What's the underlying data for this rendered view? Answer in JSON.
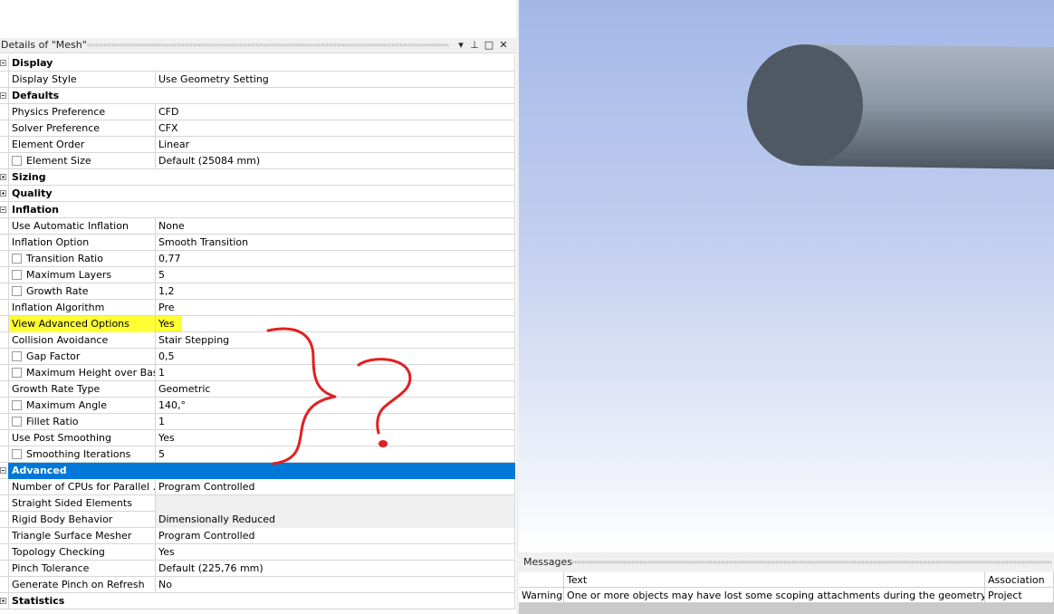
{
  "details_panel": {
    "title": "Details of \"Mesh\"",
    "header_icons": {
      "dropdown": "▾",
      "pin": "⊥",
      "maximize": "□",
      "close": "✕"
    }
  },
  "rows": [
    {
      "type": "section",
      "label": "Display",
      "toggle": "minus"
    },
    {
      "type": "prop",
      "label": "Display Style",
      "value": "Use Geometry Setting"
    },
    {
      "type": "section",
      "label": "Defaults",
      "toggle": "minus"
    },
    {
      "type": "prop",
      "label": "Physics Preference",
      "value": "CFD"
    },
    {
      "type": "prop",
      "label": "Solver Preference",
      "value": "CFX"
    },
    {
      "type": "prop",
      "label": "Element Order",
      "value": "Linear"
    },
    {
      "type": "prop",
      "label": "Element Size",
      "value": "Default (25084 mm)",
      "checkbox": true
    },
    {
      "type": "section",
      "label": "Sizing",
      "toggle": "plus"
    },
    {
      "type": "section",
      "label": "Quality",
      "toggle": "plus"
    },
    {
      "type": "section",
      "label": "Inflation",
      "toggle": "minus"
    },
    {
      "type": "prop",
      "label": "Use Automatic Inflation",
      "value": "None"
    },
    {
      "type": "prop",
      "label": "Inflation Option",
      "value": "Smooth Transition"
    },
    {
      "type": "prop",
      "label": "Transition Ratio",
      "value": "0,77",
      "checkbox": true
    },
    {
      "type": "prop",
      "label": "Maximum Layers",
      "value": "5",
      "checkbox": true
    },
    {
      "type": "prop",
      "label": "Growth Rate",
      "value": "1,2",
      "checkbox": true
    },
    {
      "type": "prop",
      "label": "Inflation Algorithm",
      "value": "Pre"
    },
    {
      "type": "prop",
      "label": "View Advanced Options",
      "value": "Yes",
      "highlight": true
    },
    {
      "type": "prop",
      "label": "Collision Avoidance",
      "value": "Stair Stepping"
    },
    {
      "type": "prop",
      "label": "Gap Factor",
      "value": "0,5",
      "checkbox": true
    },
    {
      "type": "prop",
      "label": "Maximum Height over Base",
      "value": "1",
      "checkbox": true
    },
    {
      "type": "prop",
      "label": "Growth Rate Type",
      "value": "Geometric"
    },
    {
      "type": "prop",
      "label": "Maximum Angle",
      "value": "140,°",
      "checkbox": true
    },
    {
      "type": "prop",
      "label": "Fillet Ratio",
      "value": "1",
      "checkbox": true
    },
    {
      "type": "prop",
      "label": "Use Post Smoothing",
      "value": "Yes"
    },
    {
      "type": "prop",
      "label": "Smoothing Iterations",
      "value": "5",
      "checkbox": true
    },
    {
      "type": "section",
      "label": "Advanced",
      "toggle": "minus",
      "selected": true
    },
    {
      "type": "prop",
      "label": "Number of CPUs for Parallel ...",
      "value": "Program Controlled"
    },
    {
      "type": "prop",
      "label": "Straight Sided Elements",
      "value": "",
      "gray": true
    },
    {
      "type": "prop",
      "label": "Rigid Body Behavior",
      "value": "Dimensionally Reduced",
      "gray": true
    },
    {
      "type": "prop",
      "label": "Triangle Surface Mesher",
      "value": "Program Controlled"
    },
    {
      "type": "prop",
      "label": "Topology Checking",
      "value": "Yes"
    },
    {
      "type": "prop",
      "label": "Pinch Tolerance",
      "value": "Default (225,76 mm)"
    },
    {
      "type": "prop",
      "label": "Generate Pinch on Refresh",
      "value": "No"
    },
    {
      "type": "section",
      "label": "Statistics",
      "toggle": "plus"
    }
  ],
  "messages_panel": {
    "title": "Messages",
    "columns": [
      "",
      "Text",
      "Association"
    ],
    "rows": [
      {
        "type": "Warning",
        "text": "One or more objects may have lost some scoping attachments during the geometry up",
        "association": "Project"
      }
    ]
  },
  "colors": {
    "selection": "#0078d7",
    "highlight": "#ffff33",
    "annotation": "#e02020",
    "viewport_top": "#a3b7e8",
    "viewport_bottom": "#ffffff",
    "cylinder_face": "#4e5964"
  }
}
